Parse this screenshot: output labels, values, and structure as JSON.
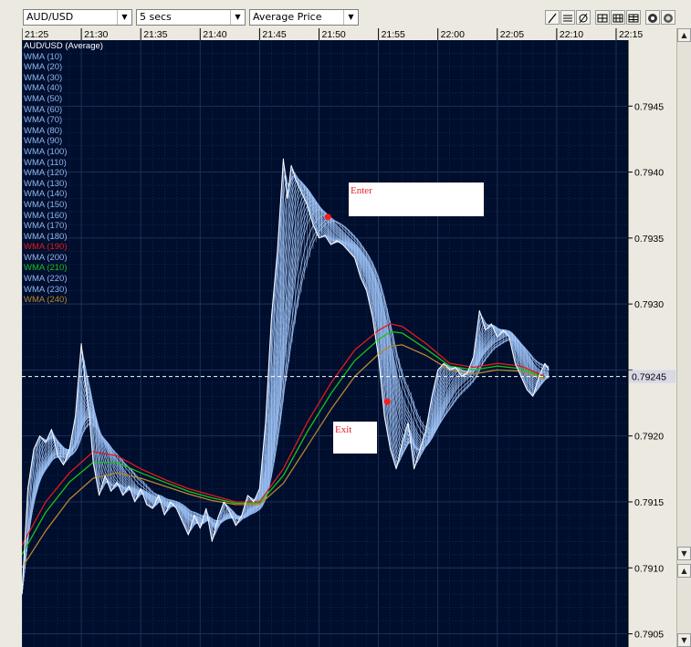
{
  "toolbar": {
    "symbol": "AUD/USD",
    "interval": "5 secs",
    "price_type": "Average Price",
    "buttons": [
      "draw-line-icon",
      "fibonacci-icon",
      "no-draw-icon",
      "grid-layout-1-icon",
      "grid-layout-2-icon",
      "grid-layout-3-icon",
      "chart-settings-icon",
      "record-icon"
    ]
  },
  "colors": {
    "background": "#000e2e",
    "grid": "#1f3359",
    "price_line": "#ffffff",
    "wma_blue": "#8fb6ec",
    "wma_190": "#e11b1b",
    "wma_210": "#19c31a",
    "wma_240": "#b8862b",
    "last_price_line": "#ffffff",
    "marker": "#ff1a1a"
  },
  "chart_data": {
    "type": "line",
    "title": "AUD/USD (Average)",
    "x_ticks": [
      "21:25",
      "21:30",
      "21:35",
      "21:40",
      "21:45",
      "21:50",
      "21:55",
      "22:00",
      "22:05",
      "22:10",
      "22:15"
    ],
    "y_ticks": [
      0.7945,
      0.794,
      0.7935,
      0.793,
      0.7925,
      0.792,
      0.7915,
      0.791,
      0.7905
    ],
    "y_tick_labels": [
      "0.7945",
      "0.7940",
      "0.7935",
      "0.7930",
      "",
      "0.7920",
      "0.7915",
      "0.7910",
      "0.7905"
    ],
    "ylim": [
      0.7904,
      0.795
    ],
    "xlim": [
      "21:25",
      "22:16"
    ],
    "grid": true,
    "last_price": 0.79245,
    "last_price_label": "0.79245",
    "legend": [
      {
        "name": "AUD/USD (Average)",
        "color": "#ffffff"
      },
      {
        "name": "WMA (10)",
        "color": "#8fb6ec"
      },
      {
        "name": "WMA (20)",
        "color": "#8fb6ec"
      },
      {
        "name": "WMA (30)",
        "color": "#8fb6ec"
      },
      {
        "name": "WMA (40)",
        "color": "#8fb6ec"
      },
      {
        "name": "WMA (50)",
        "color": "#8fb6ec"
      },
      {
        "name": "WMA (60)",
        "color": "#8fb6ec"
      },
      {
        "name": "WMA (70)",
        "color": "#8fb6ec"
      },
      {
        "name": "WMA (80)",
        "color": "#8fb6ec"
      },
      {
        "name": "WMA (90)",
        "color": "#8fb6ec"
      },
      {
        "name": "WMA (100)",
        "color": "#8fb6ec"
      },
      {
        "name": "WMA (110)",
        "color": "#8fb6ec"
      },
      {
        "name": "WMA (120)",
        "color": "#8fb6ec"
      },
      {
        "name": "WMA (130)",
        "color": "#8fb6ec"
      },
      {
        "name": "WMA (140)",
        "color": "#8fb6ec"
      },
      {
        "name": "WMA (150)",
        "color": "#8fb6ec"
      },
      {
        "name": "WMA (160)",
        "color": "#8fb6ec"
      },
      {
        "name": "WMA (170)",
        "color": "#8fb6ec"
      },
      {
        "name": "WMA (180)",
        "color": "#8fb6ec"
      },
      {
        "name": "WMA (190)",
        "color": "#e11b1b"
      },
      {
        "name": "WMA (200)",
        "color": "#8fb6ec"
      },
      {
        "name": "WMA (210)",
        "color": "#19c31a"
      },
      {
        "name": "WMA (220)",
        "color": "#8fb6ec"
      },
      {
        "name": "WMA (230)",
        "color": "#8fb6ec"
      },
      {
        "name": "WMA (240)",
        "color": "#b8862b"
      }
    ],
    "price_series": [
      [
        "21:25:00",
        0.7908
      ],
      [
        "21:25:30",
        0.7916
      ],
      [
        "21:26:00",
        0.7919
      ],
      [
        "21:26:30",
        0.792
      ],
      [
        "21:27:00",
        0.79195
      ],
      [
        "21:27:30",
        0.79205
      ],
      [
        "21:28:00",
        0.79185
      ],
      [
        "21:28:30",
        0.79178
      ],
      [
        "21:29:00",
        0.7919
      ],
      [
        "21:29:30",
        0.79215
      ],
      [
        "21:30:00",
        0.7927
      ],
      [
        "21:30:20",
        0.7924
      ],
      [
        "21:30:40",
        0.79215
      ],
      [
        "21:31:00",
        0.7918
      ],
      [
        "21:31:30",
        0.79155
      ],
      [
        "21:32:00",
        0.7917
      ],
      [
        "21:32:30",
        0.79158
      ],
      [
        "21:33:00",
        0.79165
      ],
      [
        "21:33:30",
        0.79155
      ],
      [
        "21:34:00",
        0.79162
      ],
      [
        "21:34:30",
        0.7915
      ],
      [
        "21:35:00",
        0.7916
      ],
      [
        "21:35:30",
        0.79148
      ],
      [
        "21:36:00",
        0.79145
      ],
      [
        "21:36:30",
        0.79155
      ],
      [
        "21:37:00",
        0.7914
      ],
      [
        "21:37:30",
        0.7915
      ],
      [
        "21:38:00",
        0.79145
      ],
      [
        "21:38:30",
        0.79135
      ],
      [
        "21:39:00",
        0.79125
      ],
      [
        "21:39:30",
        0.7914
      ],
      [
        "21:40:00",
        0.7913
      ],
      [
        "21:40:30",
        0.79145
      ],
      [
        "21:41:00",
        0.7912
      ],
      [
        "21:41:30",
        0.79138
      ],
      [
        "21:42:00",
        0.7915
      ],
      [
        "21:42:30",
        0.79142
      ],
      [
        "21:43:00",
        0.79132
      ],
      [
        "21:43:30",
        0.7914
      ],
      [
        "21:44:00",
        0.79155
      ],
      [
        "21:44:30",
        0.7915
      ],
      [
        "21:45:00",
        0.7916
      ],
      [
        "21:45:30",
        0.7921
      ],
      [
        "21:46:00",
        0.7929
      ],
      [
        "21:46:30",
        0.7934
      ],
      [
        "21:47:00",
        0.7941
      ],
      [
        "21:47:20",
        0.7938
      ],
      [
        "21:47:40",
        0.79405
      ],
      [
        "21:48:00",
        0.79395
      ],
      [
        "21:48:30",
        0.79385
      ],
      [
        "21:49:00",
        0.79375
      ],
      [
        "21:49:30",
        0.7936
      ],
      [
        "21:50:00",
        0.7935
      ],
      [
        "21:50:30",
        0.79352
      ],
      [
        "21:51:00",
        0.79345
      ],
      [
        "21:51:30",
        0.79348
      ],
      [
        "21:52:00",
        0.79345
      ],
      [
        "21:52:30",
        0.7934
      ],
      [
        "21:53:00",
        0.79335
      ],
      [
        "21:53:30",
        0.7932
      ],
      [
        "21:54:00",
        0.7931
      ],
      [
        "21:54:30",
        0.7929
      ],
      [
        "21:55:00",
        0.7926
      ],
      [
        "21:55:30",
        0.79215
      ],
      [
        "21:56:00",
        0.7919
      ],
      [
        "21:56:30",
        0.79175
      ],
      [
        "21:57:00",
        0.79195
      ],
      [
        "21:57:30",
        0.7921
      ],
      [
        "21:58:00",
        0.79175
      ],
      [
        "21:58:30",
        0.7919
      ],
      [
        "21:59:00",
        0.79205
      ],
      [
        "21:59:30",
        0.7923
      ],
      [
        "22:00:00",
        0.7925
      ],
      [
        "22:00:30",
        0.79255
      ],
      [
        "22:01:00",
        0.7925
      ],
      [
        "22:01:30",
        0.79252
      ],
      [
        "22:02:00",
        0.79245
      ],
      [
        "22:02:30",
        0.79248
      ],
      [
        "22:03:00",
        0.7926
      ],
      [
        "22:03:30",
        0.79295
      ],
      [
        "22:04:00",
        0.7928
      ],
      [
        "22:04:30",
        0.79285
      ],
      [
        "22:05:00",
        0.79275
      ],
      [
        "22:05:30",
        0.7928
      ],
      [
        "22:06:00",
        0.79275
      ],
      [
        "22:06:30",
        0.79255
      ],
      [
        "22:07:00",
        0.79245
      ],
      [
        "22:07:30",
        0.79235
      ],
      [
        "22:08:00",
        0.7923
      ],
      [
        "22:08:30",
        0.79245
      ],
      [
        "22:09:00",
        0.79255
      ],
      [
        "22:09:20",
        0.7925
      ]
    ],
    "wma_190_series": [
      [
        "21:25:00",
        0.79117
      ],
      [
        "21:27:00",
        0.7915
      ],
      [
        "21:29:00",
        0.79172
      ],
      [
        "21:31:00",
        0.79188
      ],
      [
        "21:33:00",
        0.79185
      ],
      [
        "21:35:00",
        0.79175
      ],
      [
        "21:37:00",
        0.79167
      ],
      [
        "21:39:00",
        0.7916
      ],
      [
        "21:41:00",
        0.79155
      ],
      [
        "21:43:00",
        0.7915
      ],
      [
        "21:45:00",
        0.7915
      ],
      [
        "21:47:00",
        0.79175
      ],
      [
        "21:49:00",
        0.7921
      ],
      [
        "21:51:00",
        0.7924
      ],
      [
        "21:53:00",
        0.79265
      ],
      [
        "21:55:00",
        0.7928
      ],
      [
        "21:56:00",
        0.79285
      ],
      [
        "21:57:00",
        0.79283
      ],
      [
        "21:59:00",
        0.7927
      ],
      [
        "22:01:00",
        0.79255
      ],
      [
        "22:03:00",
        0.79252
      ],
      [
        "22:05:00",
        0.79255
      ],
      [
        "22:07:00",
        0.79253
      ],
      [
        "22:09:00",
        0.79245
      ]
    ],
    "wma_210_series": [
      [
        "21:25:00",
        0.7911
      ],
      [
        "21:27:00",
        0.79142
      ],
      [
        "21:29:00",
        0.79165
      ],
      [
        "21:31:00",
        0.7918
      ],
      [
        "21:33:00",
        0.7918
      ],
      [
        "21:35:00",
        0.79172
      ],
      [
        "21:37:00",
        0.79165
      ],
      [
        "21:39:00",
        0.79158
      ],
      [
        "21:41:00",
        0.79153
      ],
      [
        "21:43:00",
        0.79149
      ],
      [
        "21:45:00",
        0.79149
      ],
      [
        "21:47:00",
        0.7917
      ],
      [
        "21:49:00",
        0.79203
      ],
      [
        "21:51:00",
        0.79232
      ],
      [
        "21:53:00",
        0.79257
      ],
      [
        "21:55:00",
        0.79273
      ],
      [
        "21:56:00",
        0.79279
      ],
      [
        "21:57:00",
        0.79278
      ],
      [
        "21:59:00",
        0.79266
      ],
      [
        "22:01:00",
        0.79253
      ],
      [
        "22:03:00",
        0.7925
      ],
      [
        "22:05:00",
        0.79253
      ],
      [
        "22:07:00",
        0.79251
      ],
      [
        "22:09:00",
        0.79244
      ]
    ],
    "wma_240_series": [
      [
        "21:25:00",
        0.791
      ],
      [
        "21:27:00",
        0.79128
      ],
      [
        "21:29:00",
        0.79152
      ],
      [
        "21:31:00",
        0.79168
      ],
      [
        "21:33:00",
        0.79172
      ],
      [
        "21:35:00",
        0.79168
      ],
      [
        "21:37:00",
        0.79162
      ],
      [
        "21:39:00",
        0.79156
      ],
      [
        "21:41:00",
        0.79151
      ],
      [
        "21:43:00",
        0.79148
      ],
      [
        "21:45:00",
        0.79148
      ],
      [
        "21:47:00",
        0.79164
      ],
      [
        "21:49:00",
        0.79192
      ],
      [
        "21:51:00",
        0.7922
      ],
      [
        "21:53:00",
        0.79245
      ],
      [
        "21:55:00",
        0.79262
      ],
      [
        "21:56:00",
        0.79268
      ],
      [
        "21:57:00",
        0.79269
      ],
      [
        "21:59:00",
        0.79261
      ],
      [
        "22:01:00",
        0.7925
      ],
      [
        "22:03:00",
        0.79247
      ],
      [
        "22:05:00",
        0.7925
      ],
      [
        "22:07:00",
        0.79249
      ],
      [
        "22:09:00",
        0.79243
      ]
    ],
    "annotations": [
      {
        "label": "Enter",
        "time": "21:50:45",
        "price": 0.79366
      },
      {
        "label": "Exit",
        "time": "21:55:45",
        "price": 0.79226
      }
    ]
  }
}
